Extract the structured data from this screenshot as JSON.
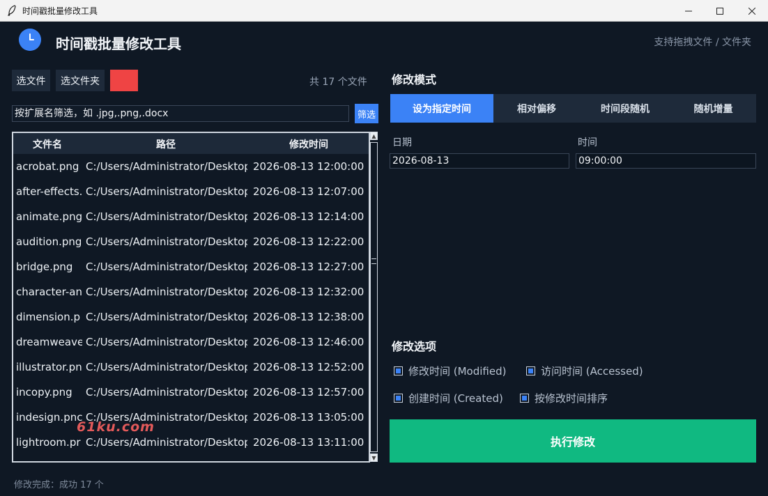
{
  "window": {
    "title": "时间戳批量修改工具"
  },
  "header": {
    "title": "时间戳批量修改工具",
    "hint": "支持拖拽文件 / 文件夹"
  },
  "toolbar": {
    "select_files": "选文件",
    "select_folder": "选文件夹",
    "count": "共 17 个文件"
  },
  "filter": {
    "value": "按扩展名筛选，如 .jpg,.png,.docx",
    "button": "筛选"
  },
  "table": {
    "columns": [
      "文件名",
      "路径",
      "修改时间"
    ],
    "rows": [
      {
        "name": "acrobat.png",
        "path": "C:/Users/Administrator/Desktop",
        "time": "2026-08-13 12:00:00"
      },
      {
        "name": "after-effects.",
        "path": "C:/Users/Administrator/Desktop",
        "time": "2026-08-13 12:07:00"
      },
      {
        "name": "animate.png",
        "path": "C:/Users/Administrator/Desktop",
        "time": "2026-08-13 12:14:00"
      },
      {
        "name": "audition.png",
        "path": "C:/Users/Administrator/Desktop",
        "time": "2026-08-13 12:22:00"
      },
      {
        "name": "bridge.png",
        "path": "C:/Users/Administrator/Desktop",
        "time": "2026-08-13 12:27:00"
      },
      {
        "name": "character-an",
        "path": "C:/Users/Administrator/Desktop",
        "time": "2026-08-13 12:32:00"
      },
      {
        "name": "dimension.p",
        "path": "C:/Users/Administrator/Desktop",
        "time": "2026-08-13 12:38:00"
      },
      {
        "name": "dreamweave",
        "path": "C:/Users/Administrator/Desktop",
        "time": "2026-08-13 12:46:00"
      },
      {
        "name": "illustrator.pn",
        "path": "C:/Users/Administrator/Desktop",
        "time": "2026-08-13 12:52:00"
      },
      {
        "name": "incopy.png",
        "path": "C:/Users/Administrator/Desktop",
        "time": "2026-08-13 12:57:00"
      },
      {
        "name": "indesign.pnc",
        "path": "C:/Users/Administrator/Desktop",
        "time": "2026-08-13 13:05:00"
      },
      {
        "name": "lightroom.pr",
        "path": "C:/Users/Administrator/Desktop",
        "time": "2026-08-13 13:11:00"
      }
    ]
  },
  "watermark": "61ku.com",
  "status": "修改完成：成功 17 个",
  "mode": {
    "title": "修改模式",
    "tabs": [
      "设为指定时间",
      "相对偏移",
      "时间段随机",
      "随机增量"
    ],
    "active_tab": 0,
    "date_label": "日期",
    "date_value": "2026-08-13",
    "time_label": "时间",
    "time_value": "09:00:00"
  },
  "options": {
    "title": "修改选项",
    "modified": "修改时间 (Modified)",
    "accessed": "访问时间 (Accessed)",
    "created": "创建时间 (Created)",
    "sort": "按修改时间排序"
  },
  "execute": "执行修改",
  "colors": {
    "accent": "#3b82f6",
    "execute": "#10b981",
    "red_swatch": "#ef4444",
    "background": "#0f1824"
  }
}
